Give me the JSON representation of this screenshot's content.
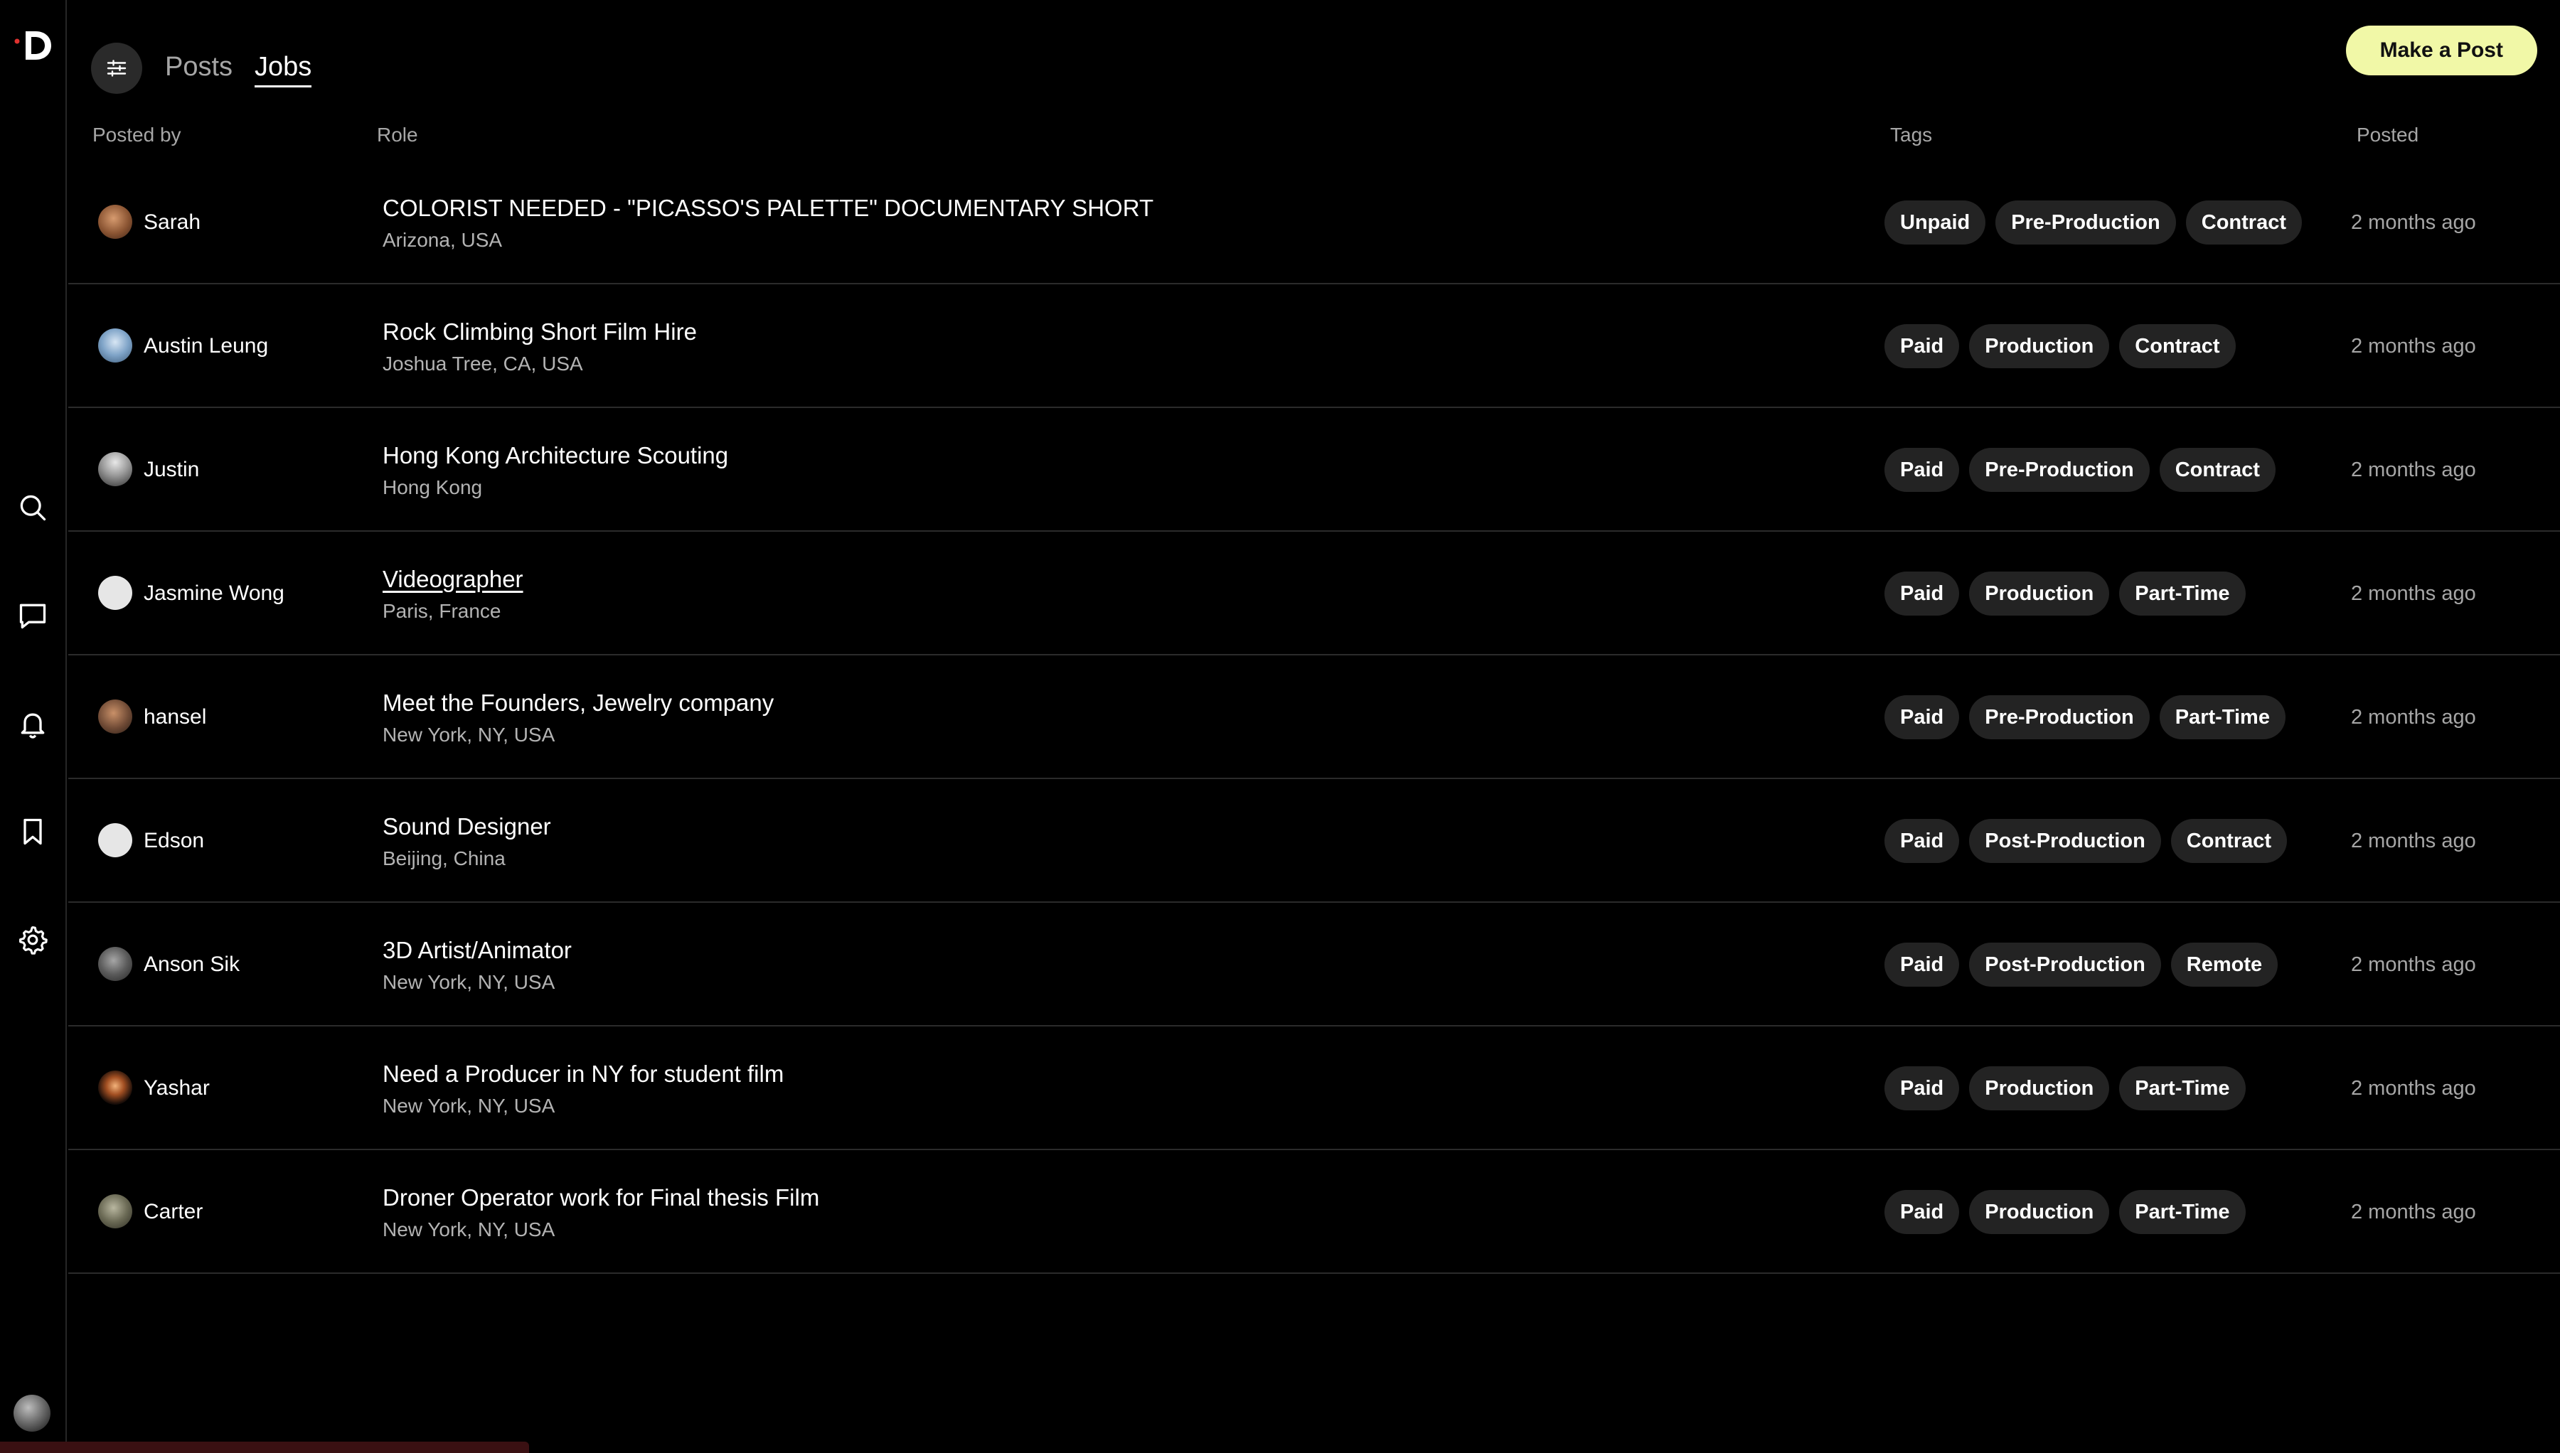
{
  "app": {
    "logo_icon": "d-logo-icon",
    "accent": "#f1f8a7"
  },
  "nav": {
    "tabs": [
      {
        "label": "Posts",
        "active": false
      },
      {
        "label": "Jobs",
        "active": true
      }
    ],
    "filter_icon": "sliders-icon",
    "make_post_label": "Make a Post"
  },
  "sidebar": {
    "icons": [
      "search-icon",
      "message-icon",
      "bell-icon",
      "bookmark-icon",
      "gear-icon"
    ],
    "profile": "user-avatar"
  },
  "table": {
    "headers": {
      "posted_by": "Posted by",
      "role": "Role",
      "tags": "Tags",
      "posted": "Posted"
    },
    "rows": [
      {
        "poster": "Sarah",
        "title": "COLORIST NEEDED - \"PICASSO'S PALETTE\" DOCUMENTARY SHORT",
        "location": "Arizona, USA",
        "tags": [
          "Unpaid",
          "Pre-Production",
          "Contract"
        ],
        "posted": "2 months ago"
      },
      {
        "poster": "Austin Leung",
        "title": "Rock Climbing Short Film Hire",
        "location": "Joshua Tree, CA, USA",
        "tags": [
          "Paid",
          "Production",
          "Contract"
        ],
        "posted": "2 months ago"
      },
      {
        "poster": "Justin",
        "title": "Hong Kong Architecture Scouting",
        "location": "Hong Kong",
        "tags": [
          "Paid",
          "Pre-Production",
          "Contract"
        ],
        "posted": "2 months ago"
      },
      {
        "poster": "Jasmine Wong",
        "title": "Videographer",
        "location": "Paris, France",
        "tags": [
          "Paid",
          "Production",
          "Part-Time"
        ],
        "posted": "2 months ago"
      },
      {
        "poster": "hansel",
        "title": "Meet the Founders, Jewelry company",
        "location": "New York, NY, USA",
        "tags": [
          "Paid",
          "Pre-Production",
          "Part-Time"
        ],
        "posted": "2 months ago"
      },
      {
        "poster": "Edson",
        "title": "Sound Designer",
        "location": "Beijing, China",
        "tags": [
          "Paid",
          "Post-Production",
          "Contract"
        ],
        "posted": "2 months ago"
      },
      {
        "poster": "Anson Sik",
        "title": "3D Artist/Animator",
        "location": "New York, NY, USA",
        "tags": [
          "Paid",
          "Post-Production",
          "Remote"
        ],
        "posted": "2 months ago"
      },
      {
        "poster": "Yashar",
        "title": "Need a Producer in NY for student film",
        "location": "New York, NY, USA",
        "tags": [
          "Paid",
          "Production",
          "Part-Time"
        ],
        "posted": "2 months ago"
      },
      {
        "poster": "Carter",
        "title": "Droner Operator work for Final thesis Film",
        "location": "New York, NY, USA",
        "tags": [
          "Paid",
          "Production",
          "Part-Time"
        ],
        "posted": "2 months ago"
      }
    ]
  }
}
